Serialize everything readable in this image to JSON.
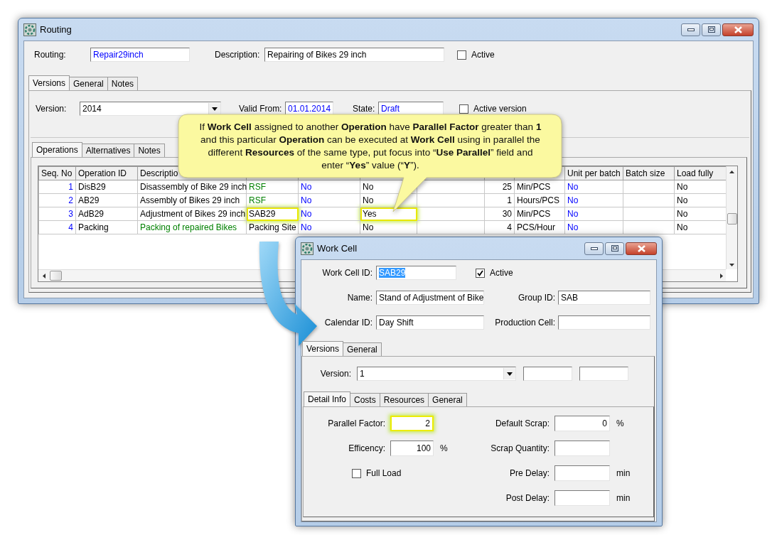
{
  "routing_window": {
    "title": "Routing",
    "routing": {
      "label": "Routing:",
      "value": "Repair29inch",
      "color": "#0000ff"
    },
    "description": {
      "label": "Description:",
      "value": "Repairing of Bikes 29 inch"
    },
    "active": {
      "label": "Active",
      "checked": false
    },
    "tabs": [
      {
        "label": "Versions",
        "selected": true
      },
      {
        "label": "General",
        "selected": false
      },
      {
        "label": "Notes",
        "selected": false
      }
    ],
    "version": {
      "label": "Version:",
      "value": "2014"
    },
    "valid_from": {
      "label": "Valid From:",
      "value": "01.01.2014",
      "color": "#0000ff"
    },
    "state": {
      "label": "State:",
      "value": "Draft",
      "color": "#0000ff"
    },
    "active_version": {
      "label": "Active version",
      "checked": false
    },
    "operation_tabs": [
      {
        "label": "Operations",
        "selected": true
      },
      {
        "label": "Alternatives",
        "selected": false
      },
      {
        "label": "Notes",
        "selected": false
      }
    ],
    "table": {
      "columns": [
        {
          "header": "Seq. No",
          "kind": "number"
        },
        {
          "header": "Operation ID",
          "kind": "text"
        },
        {
          "header": "Descriptio",
          "kind": "text"
        },
        {
          "kind": "text"
        },
        {
          "kind": "text"
        },
        {
          "kind": "text"
        },
        {
          "kind": "text"
        },
        {
          "kind": "number"
        },
        {
          "kind": "text"
        },
        {
          "header": "Unit per batch",
          "kind": "text"
        },
        {
          "header": "Batch size",
          "kind": "text"
        },
        {
          "header": "Load fully",
          "kind": "text"
        }
      ],
      "rows": [
        {
          "cells": [
            {
              "text": "1",
              "color": "#0000ff"
            },
            {
              "text": "DisB29"
            },
            {
              "text": "Disassembly of Bike 29 inch"
            },
            {
              "text": "RSF",
              "color": "#008000"
            },
            {
              "text": "No",
              "color": "#0000ff"
            },
            {
              "text": "No"
            },
            null,
            {
              "text": "25"
            },
            {
              "text": "Min/PCS"
            },
            {
              "text": "No",
              "color": "#0000ff"
            },
            null,
            {
              "text": "No"
            }
          ]
        },
        {
          "cells": [
            {
              "text": "2",
              "color": "#0000ff"
            },
            {
              "text": "AB29"
            },
            {
              "text": "Assembly of Bikes 29 inch"
            },
            {
              "text": "RSF",
              "color": "#008000"
            },
            {
              "text": "No",
              "color": "#0000ff"
            },
            {
              "text": "No"
            },
            null,
            {
              "text": "1"
            },
            {
              "text": "Hours/PCS"
            },
            {
              "text": "No",
              "color": "#0000ff"
            },
            null,
            {
              "text": "No"
            }
          ]
        },
        {
          "cells": [
            {
              "text": "3",
              "color": "#0000ff"
            },
            {
              "text": "AdB29"
            },
            {
              "text": "Adjustment of Bikes 29 inch"
            },
            {
              "text": "SAB29",
              "highlighted": true
            },
            {
              "text": "No",
              "color": "#0000ff"
            },
            {
              "text": "Yes",
              "highlighted": true
            },
            null,
            {
              "text": "30"
            },
            {
              "text": "Min/PCS"
            },
            {
              "text": "No",
              "color": "#0000ff"
            },
            null,
            {
              "text": "No"
            }
          ]
        },
        {
          "cells": [
            {
              "text": "4",
              "color": "#0000ff"
            },
            {
              "text": "Packing"
            },
            {
              "text": "Packing of repaired Bikes",
              "color": "#008000"
            },
            {
              "text": "Packing Site"
            },
            {
              "text": "No",
              "color": "#0000ff"
            },
            {
              "text": "No"
            },
            null,
            {
              "text": "4"
            },
            {
              "text": "PCS/Hour"
            },
            {
              "text": "No",
              "color": "#0000ff"
            },
            null,
            {
              "text": "No"
            }
          ]
        }
      ]
    }
  },
  "work_cell_window": {
    "title": "Work Cell",
    "work_cell_id": {
      "label": "Work Cell ID:",
      "value": "SAB29",
      "text_selected": true
    },
    "active": {
      "label": "Active",
      "checked": true
    },
    "name": {
      "label": "Name:",
      "value": "Stand of Adjustment of Bike"
    },
    "group_id": {
      "label": "Group ID:",
      "value": "SAB"
    },
    "calendar_id": {
      "label": "Calendar ID:",
      "value": "Day Shift"
    },
    "production_cell": {
      "label": "Production Cell:"
    },
    "tabs": [
      {
        "label": "Versions",
        "selected": true
      },
      {
        "label": "General",
        "selected": false
      }
    ],
    "version": {
      "label": "Version:",
      "value": "1"
    },
    "detail_tabs": [
      {
        "label": "Detail Info",
        "selected": true
      },
      {
        "label": "Costs",
        "selected": false
      },
      {
        "label": "Resources",
        "selected": false
      },
      {
        "label": "General",
        "selected": false
      }
    ],
    "parallel_factor": {
      "label": "Parallel Factor:",
      "value": "2",
      "highlighted": true
    },
    "efficiency": {
      "label": "Efficency:",
      "value": "100",
      "unit": "%"
    },
    "full_load": {
      "label": "Full Load",
      "checked": false
    },
    "default_scrap": {
      "label": "Default Scrap:",
      "value": "0",
      "unit": "%"
    },
    "scrap_quantity": {
      "label": "Scrap Quantity:"
    },
    "pre_delay": {
      "label": "Pre Delay:",
      "unit": "min"
    },
    "post_delay": {
      "label": "Post Delay:",
      "unit": "min"
    }
  },
  "callout": {
    "text": "If **Work Cell** assigned to another **Operation** have **Parallel Factor** greater than **1** and this particular **Operation** can be executed at **Work Cell** using in parallel the different **Resources** of the same type, put focus into “**Use Parallel**” field and enter “**Yes**” value (“**Y**”)."
  }
}
